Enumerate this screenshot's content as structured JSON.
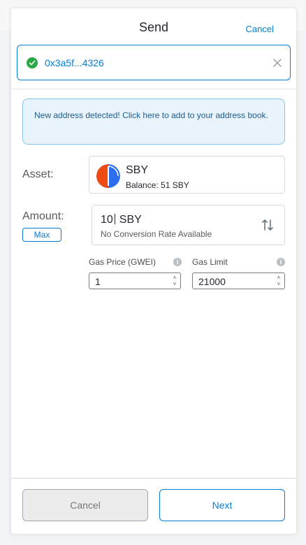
{
  "header": {
    "title": "Send",
    "cancel_label": "Cancel"
  },
  "recipient": {
    "address": "0x3a5f...4326",
    "status_icon": "check-circle-icon",
    "clear_icon": "close-icon"
  },
  "notice": {
    "text": "New address detected! Click here to add to your address book."
  },
  "asset": {
    "label": "Asset:",
    "symbol": "SBY",
    "balance": "Balance: 51 SBY"
  },
  "amount": {
    "label": "Amount:",
    "max_label": "Max",
    "value": "10",
    "unit": "SBY",
    "conversion": "No Conversion Rate Available"
  },
  "gas": {
    "price_label": "Gas Price (GWEI)",
    "price_value": "1",
    "limit_label": "Gas Limit",
    "limit_value": "21000"
  },
  "footer": {
    "cancel_label": "Cancel",
    "next_label": "Next"
  },
  "colors": {
    "accent": "#037dd6",
    "success": "#28a745",
    "notice_bg": "#e8f3fc",
    "asset_logo_left": "#f04a14",
    "asset_logo_right": "#2d6ef0"
  }
}
